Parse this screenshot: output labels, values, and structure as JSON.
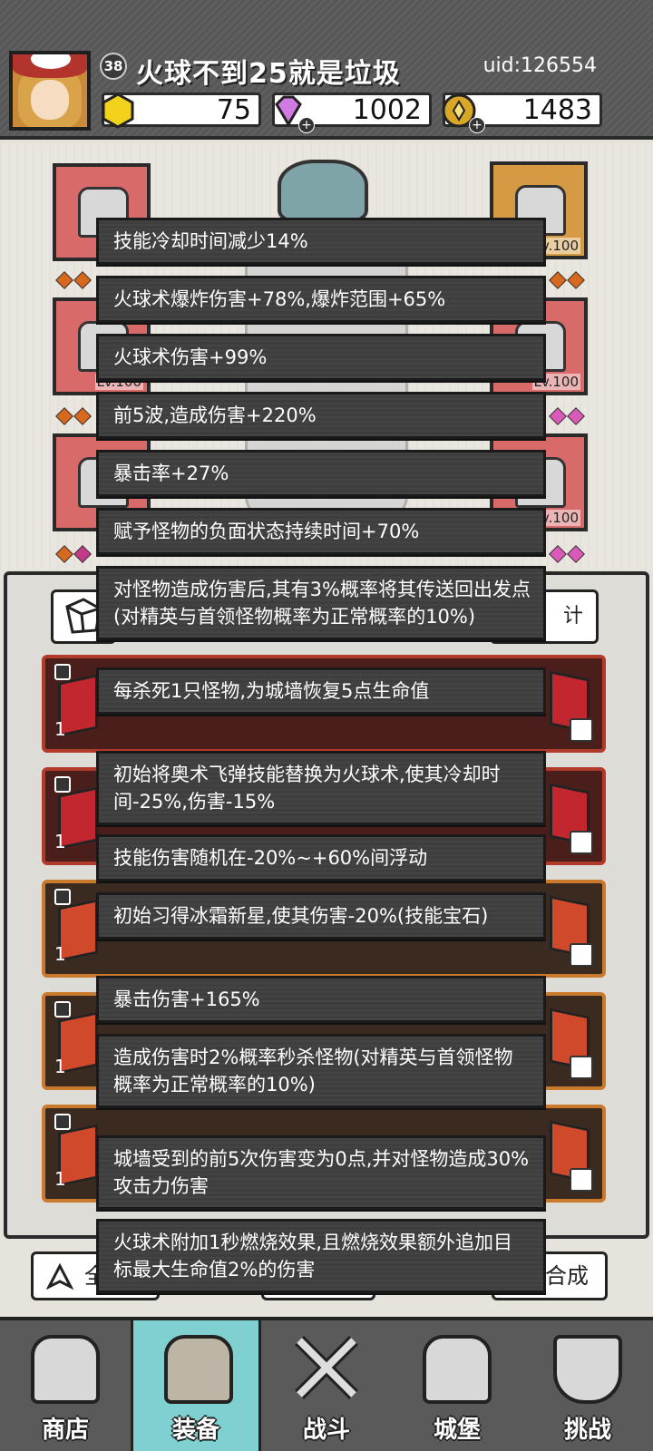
{
  "player": {
    "level": "38",
    "name": "火球不到25就是垃圾",
    "uid": "uid:126554"
  },
  "resources": {
    "gold_gem": "75",
    "diamond": "1002",
    "coin": "1483"
  },
  "equipment": {
    "slot_levels": [
      "Lv.100",
      "Lv.100",
      "Lv.100",
      "Lv.100",
      "Lv.100"
    ],
    "stats_button_label": "计"
  },
  "tooltips": [
    "技能冷却时间减少14%",
    "火球术爆炸伤害+78%,爆炸范围+65%",
    "火球术伤害+99%",
    "前5波,造成伤害+220%",
    "暴击率+27%",
    "赋予怪物的负面状态持续时间+70%",
    "对怪物造成伤害后,其有3%概率将其传送回出发点(对精英与首领怪物概率为正常概率的10%)",
    "每杀死1只怪物,为城墙恢复5点生命值",
    "初始将奥术飞弹技能替换为火球术,使其冷却时间-25%,伤害-15%",
    "技能伤害随机在-20%~+60%间浮动",
    "初始习得冰霜新星,使其伤害-20%(技能宝石)",
    "暴击伤害+165%",
    "造成伤害时2%概率秒杀怪物(对精英与首领怪物概率为正常概率的10%)",
    "城墙受到的前5次伤害变为0点,并对怪物造成30%攻击力伤害",
    "火球术附加1秒燃烧效果,且燃烧效果额外追加目标最大生命值2%的伤害"
  ],
  "gem_cards": {
    "count_label": "1"
  },
  "bottom_buttons": {
    "left_label": "全部",
    "right_label": "键合成"
  },
  "nav": [
    {
      "label": "商店",
      "icon": "shop-icon"
    },
    {
      "label": "装备",
      "icon": "backpack-icon"
    },
    {
      "label": "战斗",
      "icon": "swords-icon"
    },
    {
      "label": "城堡",
      "icon": "castle-icon"
    },
    {
      "label": "挑战",
      "icon": "shield-icon"
    }
  ],
  "colors": {
    "header_bg": "#5a5a5a",
    "tooltip_bg": "#3e3e3e",
    "nav_active": "#7fd0d0",
    "slot_red": "#d96a6a",
    "slot_gold": "#d59a43"
  }
}
